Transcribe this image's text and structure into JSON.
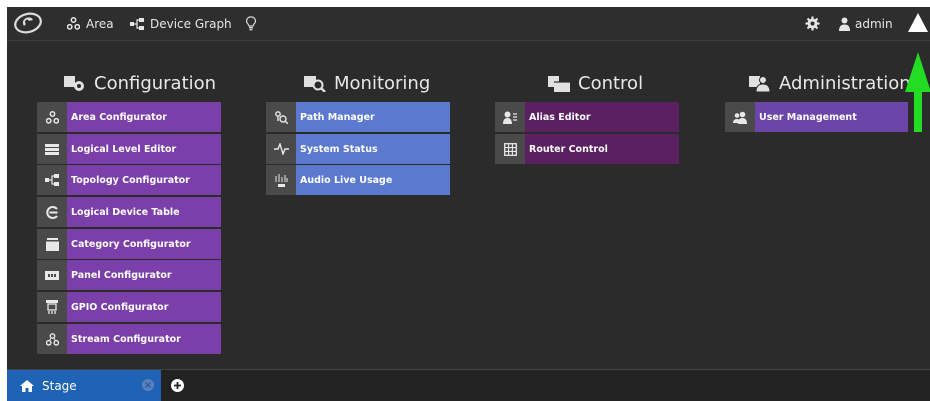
{
  "topbar": {
    "area_label": "Area",
    "device_graph_label": "Device Graph",
    "user_label": "admin"
  },
  "columns": {
    "configuration": {
      "title": "Configuration",
      "items": [
        {
          "label": "Area Configurator",
          "icon": "area-icon"
        },
        {
          "label": "Logical Level Editor",
          "icon": "layers-icon"
        },
        {
          "label": "Topology Configurator",
          "icon": "topology-icon"
        },
        {
          "label": "Logical Device Table",
          "icon": "device-table-icon"
        },
        {
          "label": "Category Configurator",
          "icon": "category-icon"
        },
        {
          "label": "Panel Configurator",
          "icon": "panel-icon"
        },
        {
          "label": "GPIO Configurator",
          "icon": "gpio-icon"
        },
        {
          "label": "Stream Configurator",
          "icon": "stream-icon"
        }
      ]
    },
    "monitoring": {
      "title": "Monitoring",
      "items": [
        {
          "label": "Path Manager",
          "icon": "path-icon"
        },
        {
          "label": "System Status",
          "icon": "pulse-icon"
        },
        {
          "label": "Audio Live Usage",
          "icon": "audio-icon"
        }
      ]
    },
    "control": {
      "title": "Control",
      "items": [
        {
          "label": "Alias Editor",
          "icon": "alias-icon"
        },
        {
          "label": "Router Control",
          "icon": "grid-icon"
        }
      ]
    },
    "administration": {
      "title": "Administration",
      "items": [
        {
          "label": "User Management",
          "icon": "users-icon"
        }
      ]
    }
  },
  "bottombar": {
    "stage_tab_label": "Stage"
  },
  "colors": {
    "configuration": "#7a3fa8",
    "monitoring": "#5a79cf",
    "control": "#5a2060",
    "administration": "#6b45a8",
    "stage_tab": "#1f63b6",
    "annotation_arrow": "#22dd22"
  }
}
